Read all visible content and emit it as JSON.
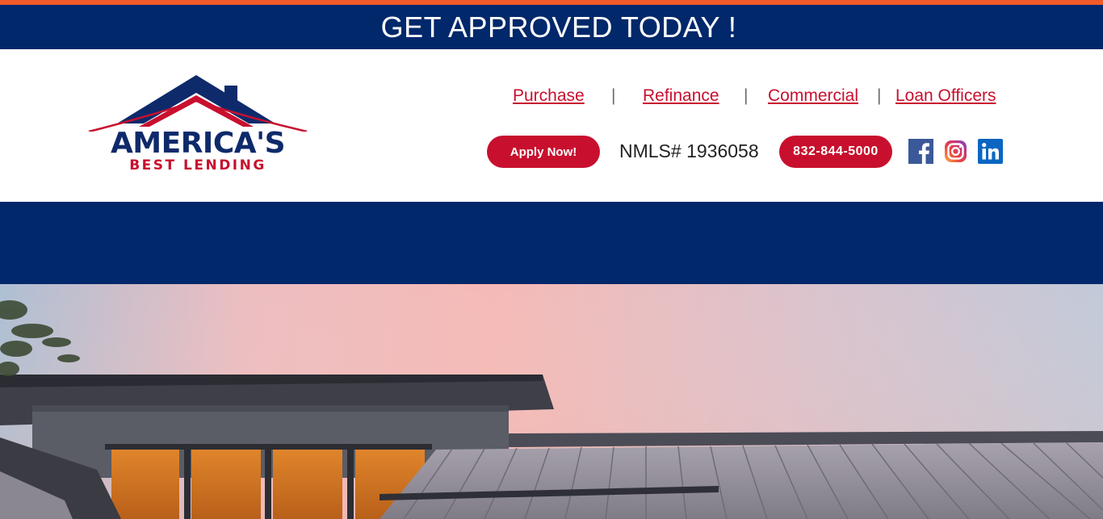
{
  "banner": {
    "text": "GET APPROVED TODAY !"
  },
  "logo": {
    "main": "AMERICA'S",
    "sub": "BEST LENDING"
  },
  "nav": {
    "items": [
      {
        "label": "Purchase"
      },
      {
        "label": "Refinance"
      },
      {
        "label": "Commercial"
      },
      {
        "label": "Loan Officers"
      }
    ],
    "separator": "|"
  },
  "actions": {
    "apply_label": "Apply Now!",
    "nmls": "NMLS# 1936058",
    "phone": "832-844-5000"
  },
  "social": [
    "facebook-icon",
    "instagram-icon",
    "linkedin-icon"
  ],
  "colors": {
    "accent_orange": "#f05a28",
    "navy": "#00286a",
    "brand_red": "#c8102e",
    "facebook": "#3b5998",
    "linkedin": "#0a66c2"
  }
}
